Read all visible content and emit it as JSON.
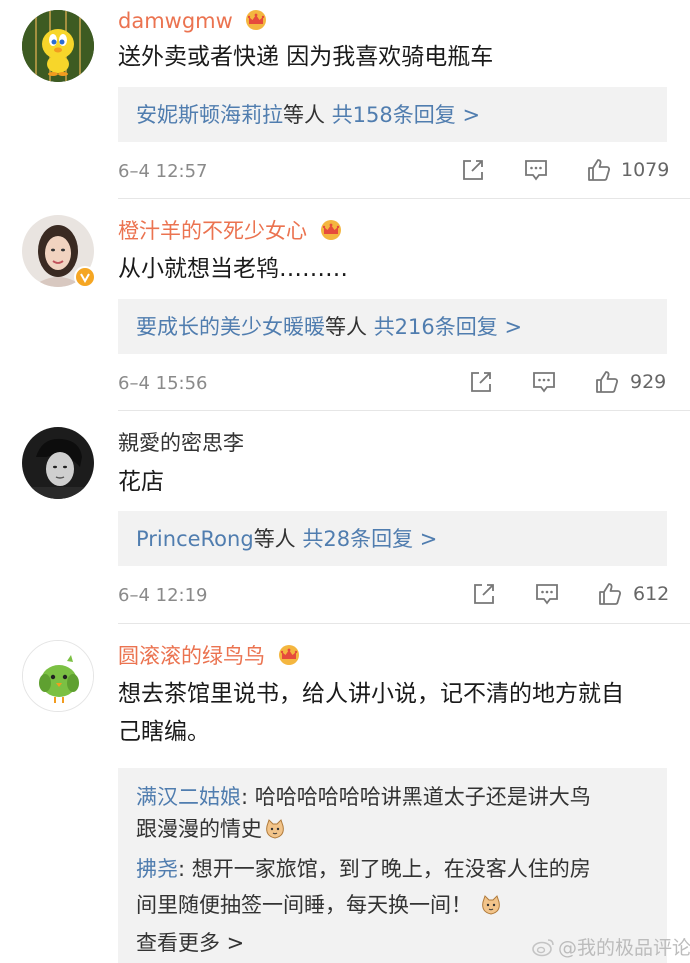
{
  "comments": [
    {
      "username": "damwgmw",
      "text": "送外卖或者快递 因为我喜欢骑电瓶车",
      "reply_names": "安妮斯顿海莉拉",
      "reply_mid": "等人",
      "reply_count": "共158条回复 >",
      "time": "6–4 12:57",
      "likes": "1079"
    },
    {
      "username": "橙汁羊的不死少女心",
      "text": "从小就想当老鸨………",
      "reply_names": "要成长的美少女暖暖",
      "reply_mid": "等人",
      "reply_count": "共216条回复 >",
      "time": "6–4 15:56",
      "likes": "929"
    },
    {
      "username": "親愛的密思李",
      "text": "花店",
      "reply_names": "PrinceRong",
      "reply_mid": "等人",
      "reply_count": "共28条回复 >",
      "time": "6–4 12:19",
      "likes": "612"
    },
    {
      "username": "圆滚滚的绿鸟鸟",
      "text_line1": "想去茶馆里说书，给人讲小说，记不清的地方就自",
      "text_line2": "己瞎编。",
      "quotes": [
        {
          "name": "满汉二姑娘",
          "line1": ": 哈哈哈哈哈哈讲黑道太子还是讲大鸟",
          "line2": "跟漫漫的情史"
        },
        {
          "name": "拂尧",
          "line1": ": 想开一家旅馆，到了晚上，在没客人住的房",
          "line2": "间里随便抽签一间睡，每天换一间！"
        }
      ],
      "view_more": "查看更多 >"
    }
  ],
  "watermark": "@我的极品评论",
  "colors": {
    "vip_name": "#eb7350",
    "link_blue": "#507daf",
    "reply_bg": "#f2f2f2",
    "meta_gray": "#8a8a8a"
  },
  "icons": [
    "crown-icon",
    "share-icon",
    "comment-icon",
    "like-icon",
    "verified-badge-icon",
    "cat-emoji-icon",
    "weibo-logo-icon"
  ]
}
